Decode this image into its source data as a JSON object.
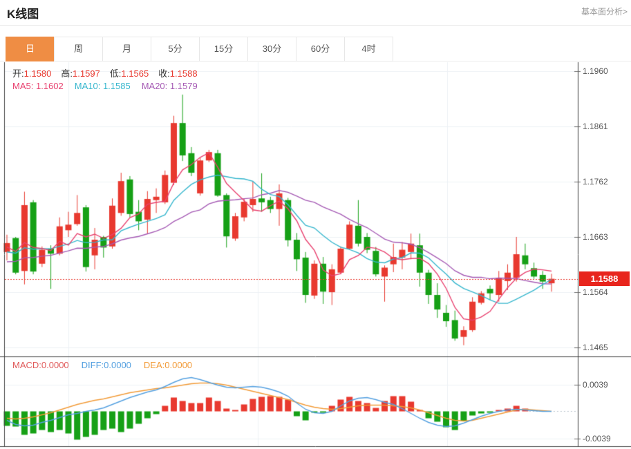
{
  "header": {
    "title": "K线图",
    "link": "基本面分析>"
  },
  "tabs": {
    "items": [
      "日",
      "周",
      "月",
      "5分",
      "15分",
      "30分",
      "60分",
      "4时"
    ],
    "active_index": 0
  },
  "ohlc": {
    "open_label": "开:",
    "open": "1.1580",
    "high_label": "高:",
    "high": "1.1597",
    "low_label": "低:",
    "low": "1.1565",
    "close_label": "收:",
    "close": "1.1588"
  },
  "ma": {
    "ma5_label": "MA5:",
    "ma5": "1.1602",
    "ma10_label": "MA10:",
    "ma10": "1.1585",
    "ma20_label": "MA20:",
    "ma20": "1.1579"
  },
  "macd_legend": {
    "macd": "MACD:0.0000",
    "diff": "DIFF:0.0000",
    "dea": "DEA:0.0000"
  },
  "price_axis": {
    "ticks": [
      "1.1960",
      "1.1861",
      "1.1762",
      "1.1663",
      "1.1564",
      "1.1465"
    ],
    "current": "1.1588"
  },
  "macd_axis": {
    "ticks": [
      "0.0039",
      "-0.0039"
    ]
  },
  "colors": {
    "up": "#e8392f",
    "down": "#16a016",
    "ma5": "#e8416f",
    "ma10": "#35b6cd",
    "ma20": "#a55ab4",
    "diff": "#54a0e0",
    "dea": "#f29b38",
    "tab_active": "#ef8d44",
    "badge": "#e8251d",
    "grid": "#edf1f5",
    "border": "#3f3f3f",
    "price_line": "#e8392f"
  },
  "chart_data": {
    "type": "candlestick",
    "interval": "日",
    "legend_note": "red = up candle, green = down candle (Chinese convention)",
    "panes": [
      {
        "name": "price",
        "ylim": [
          1.1465,
          1.196
        ],
        "yticks": [
          1.196,
          1.1861,
          1.1762,
          1.1663,
          1.1564,
          1.1465
        ],
        "current_price": 1.1588,
        "last_ohlc": {
          "open": 1.158,
          "high": 1.1597,
          "low": 1.1565,
          "close": 1.1588
        },
        "overlays": [
          {
            "name": "MA5",
            "current": 1.1602
          },
          {
            "name": "MA10",
            "current": 1.1585
          },
          {
            "name": "MA20",
            "current": 1.1579
          }
        ],
        "candles_ohlc": [
          [
            1.1636,
            1.1667,
            1.1621,
            1.1652
          ],
          [
            1.1661,
            1.1663,
            1.1596,
            1.1599
          ],
          [
            1.1602,
            1.1744,
            1.1578,
            1.172
          ],
          [
            1.1725,
            1.1729,
            1.1596,
            1.1601
          ],
          [
            1.1615,
            1.1646,
            1.1609,
            1.164
          ],
          [
            1.1642,
            1.1648,
            1.157,
            1.1633
          ],
          [
            1.1633,
            1.1698,
            1.163,
            1.1682
          ],
          [
            1.1675,
            1.1708,
            1.1663,
            1.1685
          ],
          [
            1.1686,
            1.1738,
            1.1683,
            1.1706
          ],
          [
            1.1716,
            1.172,
            1.1601,
            1.1609
          ],
          [
            1.163,
            1.1679,
            1.1605,
            1.1658
          ],
          [
            1.1663,
            1.1665,
            1.1626,
            1.1644
          ],
          [
            1.1646,
            1.1732,
            1.1642,
            1.1719
          ],
          [
            1.1706,
            1.1778,
            1.1701,
            1.1763
          ],
          [
            1.1766,
            1.1772,
            1.1698,
            1.1704
          ],
          [
            1.1708,
            1.1729,
            1.1675,
            1.1691
          ],
          [
            1.1694,
            1.1745,
            1.1669,
            1.1731
          ],
          [
            1.1729,
            1.175,
            1.1706,
            1.1735
          ],
          [
            1.1725,
            1.1782,
            1.1722,
            1.1774
          ],
          [
            1.176,
            1.188,
            1.1756,
            1.1867
          ],
          [
            1.1867,
            1.1918,
            1.1799,
            1.1809
          ],
          [
            1.1813,
            1.1824,
            1.1772,
            1.1778
          ],
          [
            1.1741,
            1.1805,
            1.1737,
            1.18
          ],
          [
            1.18,
            1.1819,
            1.1797,
            1.1815
          ],
          [
            1.1813,
            1.1819,
            1.1735,
            1.1737
          ],
          [
            1.1738,
            1.1741,
            1.1644,
            1.1664
          ],
          [
            1.166,
            1.1706,
            1.1656,
            1.17
          ],
          [
            1.1698,
            1.1732,
            1.1691,
            1.1726
          ],
          [
            1.172,
            1.1762,
            1.1708,
            1.1731
          ],
          [
            1.1732,
            1.1777,
            1.1708,
            1.1725
          ],
          [
            1.1729,
            1.1735,
            1.1706,
            1.1713
          ],
          [
            1.1713,
            1.1757,
            1.1683,
            1.1741
          ],
          [
            1.1729,
            1.1733,
            1.1646,
            1.1657
          ],
          [
            1.1658,
            1.167,
            1.1602,
            1.1623
          ],
          [
            1.1626,
            1.1636,
            1.1545,
            1.1559
          ],
          [
            1.1558,
            1.1621,
            1.1552,
            1.1615
          ],
          [
            1.1615,
            1.1627,
            1.1543,
            1.1565
          ],
          [
            1.1564,
            1.1614,
            1.1541,
            1.1605
          ],
          [
            1.1599,
            1.1646,
            1.1596,
            1.1642
          ],
          [
            1.1642,
            1.1691,
            1.164,
            1.1685
          ],
          [
            1.1683,
            1.1729,
            1.1646,
            1.1651
          ],
          [
            1.1663,
            1.167,
            1.1634,
            1.164
          ],
          [
            1.1638,
            1.1645,
            1.1592,
            1.1596
          ],
          [
            1.1592,
            1.1612,
            1.1547,
            1.1608
          ],
          [
            1.1614,
            1.1651,
            1.16,
            1.1627
          ],
          [
            1.1626,
            1.1654,
            1.1605,
            1.164
          ],
          [
            1.1636,
            1.1669,
            1.1623,
            1.1651
          ],
          [
            1.1648,
            1.1669,
            1.1574,
            1.1599
          ],
          [
            1.1599,
            1.1604,
            1.1543,
            1.1559
          ],
          [
            1.1559,
            1.158,
            1.1518,
            1.1533
          ],
          [
            1.1527,
            1.1541,
            1.1502,
            1.1512
          ],
          [
            1.1514,
            1.1531,
            1.1477,
            1.1481
          ],
          [
            1.1484,
            1.1503,
            1.1469,
            1.1496
          ],
          [
            1.1496,
            1.1555,
            1.1493,
            1.1547
          ],
          [
            1.1545,
            1.1566,
            1.1542,
            1.1562
          ],
          [
            1.157,
            1.1576,
            1.155,
            1.1562
          ],
          [
            1.1559,
            1.1602,
            1.1547,
            1.159
          ],
          [
            1.1584,
            1.1614,
            1.1568,
            1.1599
          ],
          [
            1.159,
            1.1663,
            1.1583,
            1.1632
          ],
          [
            1.163,
            1.1651,
            1.1605,
            1.1614
          ],
          [
            1.1607,
            1.1617,
            1.1588,
            1.1592
          ],
          [
            1.1595,
            1.1602,
            1.157,
            1.1583
          ],
          [
            1.158,
            1.1597,
            1.1565,
            1.1588
          ]
        ]
      },
      {
        "name": "macd",
        "ylim": [
          -0.0055,
          0.0055
        ],
        "yticks": [
          0.0039,
          -0.0039
        ],
        "current": {
          "macd": 0.0,
          "diff": 0.0,
          "dea": 0.0
        },
        "hist": [
          -0.0021,
          -0.0022,
          -0.0034,
          -0.0032,
          -0.0027,
          -0.003,
          -0.0027,
          -0.0032,
          -0.0041,
          -0.0037,
          -0.0034,
          -0.0027,
          -0.0025,
          -0.003,
          -0.0025,
          -0.0018,
          -0.001,
          -0.0004,
          0.0008,
          0.002,
          0.0015,
          0.0012,
          0.0012,
          0.002,
          0.0015,
          0.0004,
          0.0002,
          0.001,
          0.0018,
          0.0021,
          0.0022,
          0.0021,
          0.0017,
          -0.0007,
          -0.0013,
          -0.0002,
          -0.0002,
          0.0008,
          0.0017,
          0.0021,
          0.0015,
          0.0012,
          0.0005,
          0.0015,
          0.0022,
          0.0022,
          0.0014,
          0.0002,
          -0.001,
          -0.0015,
          -0.0023,
          -0.0027,
          -0.0014,
          -0.0006,
          -0.0003,
          -0.0002,
          0.0002,
          0.0004,
          0.0008,
          0.0004,
          0.0,
          0.0,
          0.0
        ],
        "diff": [
          -0.0013,
          -0.0019,
          -0.0021,
          -0.002,
          -0.0016,
          -0.0013,
          -0.0009,
          -0.0005,
          -0.0003,
          0.0,
          0.0002,
          0.0005,
          0.001,
          0.0015,
          0.002,
          0.0024,
          0.0028,
          0.0031,
          0.0036,
          0.0042,
          0.0047,
          0.0049,
          0.0046,
          0.0042,
          0.0038,
          0.0035,
          0.0034,
          0.0035,
          0.0036,
          0.0035,
          0.0032,
          0.0028,
          0.0022,
          0.0012,
          0.0003,
          -0.0002,
          -0.0003,
          0.0,
          0.0008,
          0.0015,
          0.0019,
          0.002,
          0.0017,
          0.0013,
          0.001,
          0.0004,
          -0.0003,
          -0.001,
          -0.0016,
          -0.002,
          -0.0022,
          -0.0021,
          -0.0017,
          -0.0012,
          -0.0007,
          -0.0003,
          0.0,
          0.0002,
          0.0003,
          0.0002,
          0.0001,
          0.0,
          0.0
        ],
        "dea": [
          -0.001,
          -0.0011,
          -0.001,
          -0.0008,
          -0.0005,
          -0.0002,
          0.0002,
          0.0006,
          0.001,
          0.0013,
          0.0016,
          0.0018,
          0.0021,
          0.0024,
          0.0027,
          0.0029,
          0.0031,
          0.0033,
          0.0034,
          0.0036,
          0.0038,
          0.004,
          0.0041,
          0.0041,
          0.004,
          0.0038,
          0.0035,
          0.0032,
          0.0029,
          0.0026,
          0.0023,
          0.002,
          0.0017,
          0.0013,
          0.0009,
          0.0006,
          0.0004,
          0.0003,
          0.0004,
          0.0006,
          0.0008,
          0.0009,
          0.0009,
          0.0009,
          0.0008,
          0.0007,
          0.0005,
          0.0002,
          -0.0002,
          -0.0006,
          -0.001,
          -0.0013,
          -0.0014,
          -0.0013,
          -0.001,
          -0.0007,
          -0.0004,
          -0.0001,
          0.0002,
          0.0003,
          0.0002,
          0.0001,
          0.0
        ]
      }
    ]
  }
}
